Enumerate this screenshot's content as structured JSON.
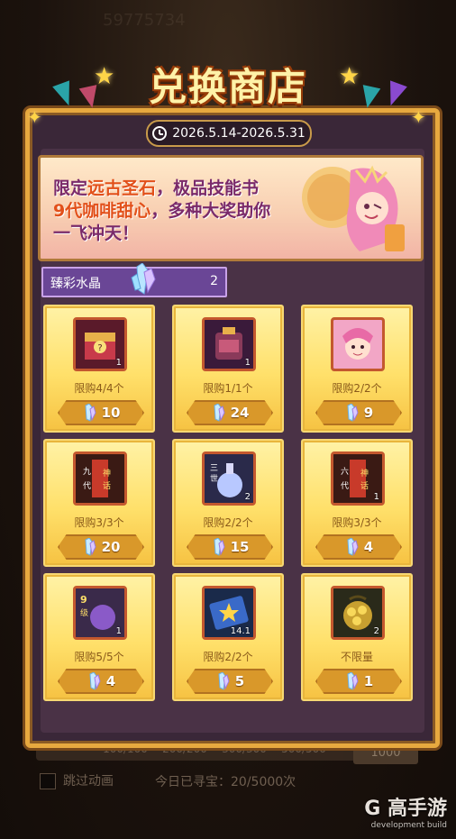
{
  "shop": {
    "title": "兑换商店",
    "date_range": "2026.5.14-2026.5.31",
    "banner": {
      "prefix": "限定",
      "highlight1": "远古圣石",
      "mid": "，极品技能书",
      "line2_highlight": "9代咖啡甜心",
      "line2_rest": "，多种大奖助你",
      "line3": "一飞冲天！"
    },
    "currency": {
      "label": "臻彩水晶",
      "value": "2"
    }
  },
  "items": [
    {
      "name": "treasure-chest",
      "limit": "限购4/4个",
      "price": "10",
      "qty": "1"
    },
    {
      "name": "skill-bag",
      "limit": "限购1/1个",
      "price": "24",
      "qty": "1"
    },
    {
      "name": "hero-portrait",
      "limit": "限购2/2个",
      "price": "9",
      "qty": ""
    },
    {
      "name": "scroll-nine",
      "limit": "限购3/3个",
      "price": "20",
      "qty": ""
    },
    {
      "name": "potion",
      "limit": "限购2/2个",
      "price": "15",
      "qty": "2"
    },
    {
      "name": "scroll-six",
      "limit": "限购3/3个",
      "price": "4",
      "qty": "1"
    },
    {
      "name": "level-nine-item",
      "limit": "限购5/5个",
      "price": "4",
      "qty": "1"
    },
    {
      "name": "ticket",
      "limit": "限购2/2个",
      "price": "5",
      "qty": "14.1"
    },
    {
      "name": "gold-coin-bag",
      "limit": "不限量",
      "price": "1",
      "qty": "2"
    }
  ],
  "background": {
    "top_number": "59775734",
    "bar_values": [
      "100/100",
      "200/200",
      "300/300",
      "500/500"
    ],
    "bar_label": "1000",
    "skip_animation": "跳过动画",
    "today_count": "今日已寻宝：20/5000次"
  },
  "watermark": {
    "brand": "G 高手游",
    "sub": "development build"
  },
  "colors": {
    "panel_border": "#e7a93f",
    "card_bg": "#ffe06a",
    "price_bg": "#d9982a",
    "currency_bg": "#6a4696"
  }
}
